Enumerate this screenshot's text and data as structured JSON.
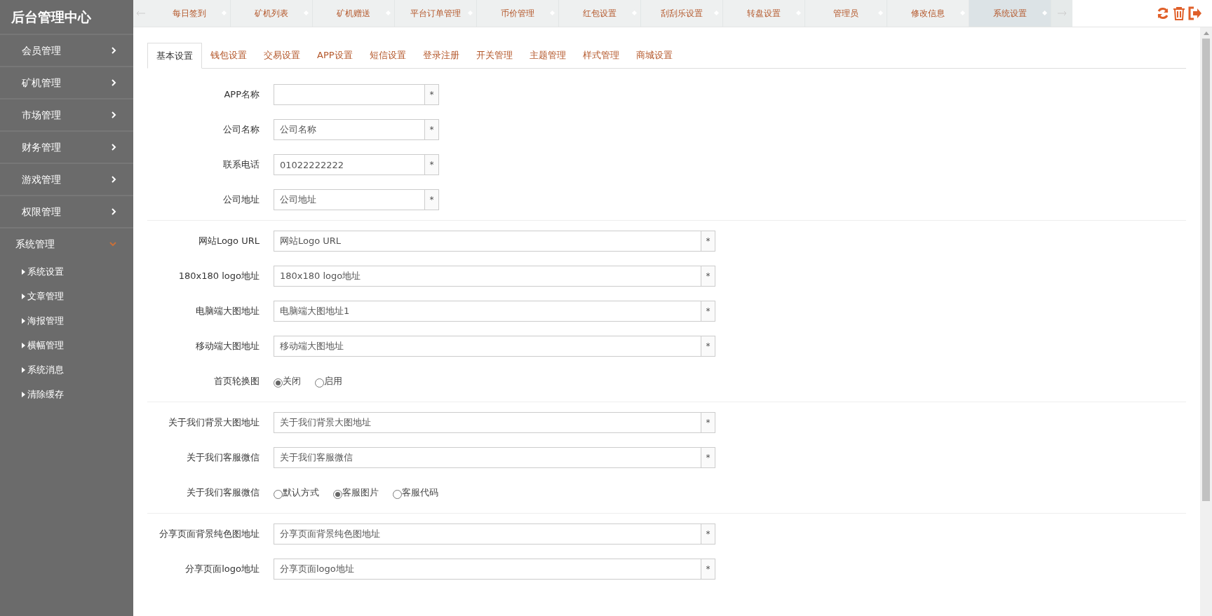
{
  "sidebar": {
    "title": "后台管理中心",
    "groups": [
      {
        "label": "会员管理",
        "expanded": false
      },
      {
        "label": "矿机管理",
        "expanded": false
      },
      {
        "label": "市场管理",
        "expanded": false
      },
      {
        "label": "财务管理",
        "expanded": false
      },
      {
        "label": "游戏管理",
        "expanded": false
      },
      {
        "label": "权限管理",
        "expanded": false
      },
      {
        "label": "系统管理",
        "expanded": true,
        "children": [
          {
            "label": "系统设置"
          },
          {
            "label": "文章管理"
          },
          {
            "label": "海报管理"
          },
          {
            "label": "横幅管理"
          },
          {
            "label": "系统消息"
          },
          {
            "label": "清除缓存"
          }
        ]
      }
    ]
  },
  "page_tabs": [
    {
      "label": "每日签到",
      "selected": false
    },
    {
      "label": "矿机列表",
      "selected": false
    },
    {
      "label": "矿机赠送",
      "selected": false
    },
    {
      "label": "平台订单管理",
      "selected": false
    },
    {
      "label": "币价管理",
      "selected": false
    },
    {
      "label": "红包设置",
      "selected": false
    },
    {
      "label": "刮刮乐设置",
      "selected": false
    },
    {
      "label": "转盘设置",
      "selected": false
    },
    {
      "label": "管理员",
      "selected": false
    },
    {
      "label": "修改信息",
      "selected": false
    },
    {
      "label": "系统设置",
      "selected": true
    }
  ],
  "settings_tabs": [
    {
      "label": "基本设置",
      "selected": true
    },
    {
      "label": "钱包设置",
      "selected": false
    },
    {
      "label": "交易设置",
      "selected": false
    },
    {
      "label": "APP设置",
      "selected": false
    },
    {
      "label": "短信设置",
      "selected": false
    },
    {
      "label": "登录注册",
      "selected": false
    },
    {
      "label": "开关管理",
      "selected": false
    },
    {
      "label": "主题管理",
      "selected": false
    },
    {
      "label": "样式管理",
      "selected": false
    },
    {
      "label": "商城设置",
      "selected": false
    }
  ],
  "sections": [
    {
      "fields": [
        {
          "kind": "short",
          "label": "APP名称",
          "required": "*"
        },
        {
          "kind": "short",
          "label": "公司名称",
          "value": "公司名称",
          "required": "*"
        },
        {
          "kind": "short",
          "label": "联系电话",
          "value": "01022222222",
          "required": "*"
        },
        {
          "kind": "short",
          "label": "公司地址",
          "value": "公司地址",
          "required": "*"
        }
      ]
    },
    {
      "fields": [
        {
          "kind": "long",
          "label": "网站Logo URL",
          "value": "网站Logo URL",
          "required": "*"
        },
        {
          "kind": "long",
          "label": "180x180 logo地址",
          "value": "180x180 logo地址",
          "required": "*"
        },
        {
          "kind": "long",
          "label": "电脑端大图地址",
          "value": "电脑端大图地址1",
          "required": "*"
        },
        {
          "kind": "long",
          "label": "移动端大图地址",
          "value": "移动端大图地址",
          "required": "*"
        },
        {
          "kind": "radio",
          "label": "首页轮换图",
          "options": [
            {
              "label": "关闭",
              "selected": true
            },
            {
              "label": "启用",
              "selected": false
            }
          ]
        }
      ]
    },
    {
      "fields": [
        {
          "kind": "long",
          "label": "关于我们背景大图地址",
          "value": "关于我们背景大图地址",
          "required": "*"
        },
        {
          "kind": "long",
          "label": "关于我们客服微信",
          "value": "关于我们客服微信",
          "required": "*"
        },
        {
          "kind": "radio",
          "label": "关于我们客服微信",
          "options": [
            {
              "label": "默认方式",
              "selected": false
            },
            {
              "label": "客服图片",
              "selected": true
            },
            {
              "label": "客服代码",
              "selected": false
            }
          ]
        }
      ]
    },
    {
      "fields": [
        {
          "kind": "long",
          "label": "分享页面背景纯色图地址",
          "value": "分享页面背景纯色图地址",
          "required": "*"
        },
        {
          "kind": "long",
          "label": "分享页面logo地址",
          "value": "分享页面logo地址",
          "required": "*"
        }
      ]
    }
  ]
}
